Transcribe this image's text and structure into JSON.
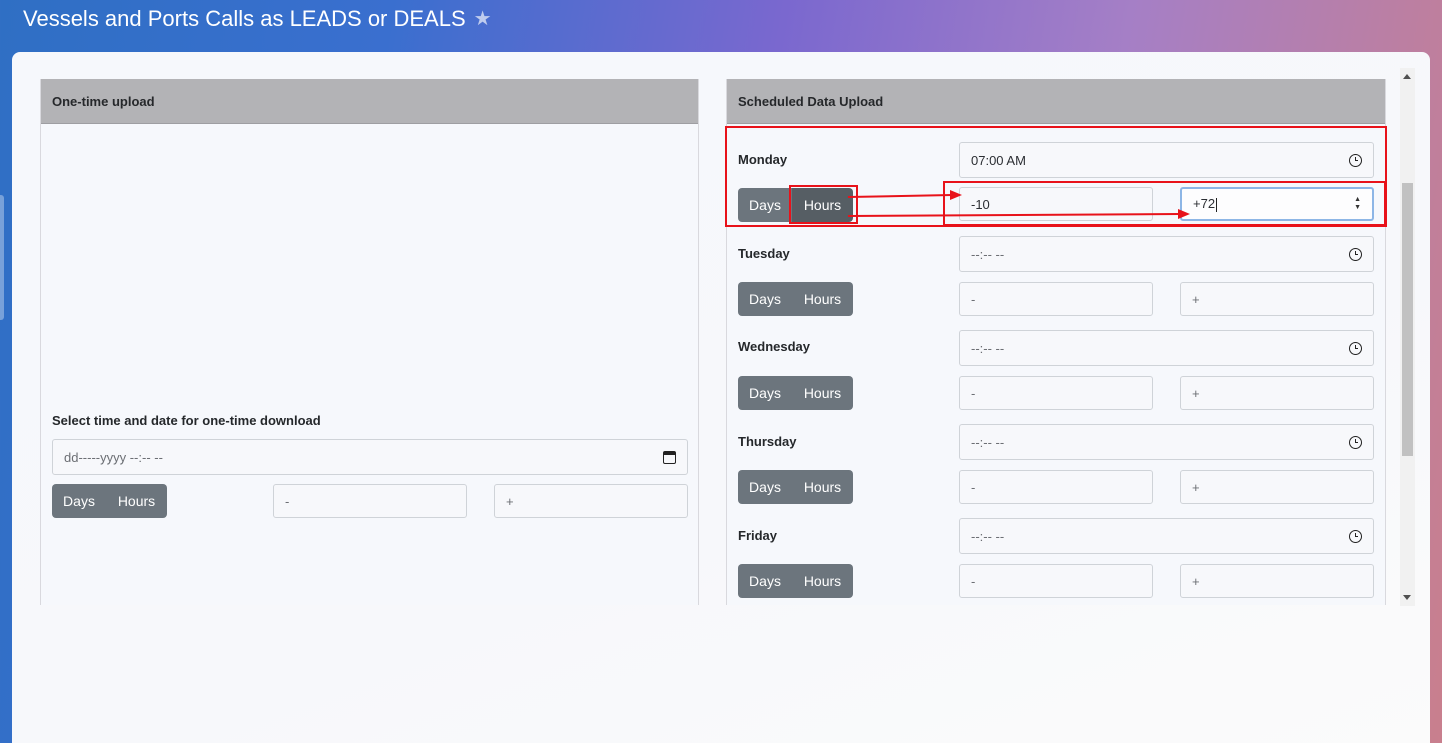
{
  "page": {
    "title": "Vessels and Ports Calls as LEADS or DEALS",
    "favorite_icon": "star-icon"
  },
  "one_time": {
    "header": "One-time upload",
    "select_label": "Select time and date for one-time download",
    "datetime_placeholder": "dd-----yyyy --:-- --",
    "days_label": "Days",
    "hours_label": "Hours",
    "minus_placeholder": "-",
    "plus_placeholder": "+"
  },
  "scheduled": {
    "header": "Scheduled Data Upload",
    "days": [
      {
        "name": "Monday",
        "time": "07:00 AM",
        "days_label": "Days",
        "hours_label": "Hours",
        "minus": "-10",
        "plus": "+72"
      },
      {
        "name": "Tuesday",
        "time": "--:-- --",
        "days_label": "Days",
        "hours_label": "Hours",
        "minus": "-",
        "plus": "+"
      },
      {
        "name": "Wednesday",
        "time": "--:-- --",
        "days_label": "Days",
        "hours_label": "Hours",
        "minus": "-",
        "plus": "+"
      },
      {
        "name": "Thursday",
        "time": "--:-- --",
        "days_label": "Days",
        "hours_label": "Hours",
        "minus": "-",
        "plus": "+"
      },
      {
        "name": "Friday",
        "time": "--:-- --",
        "days_label": "Days",
        "hours_label": "Hours",
        "minus": "-",
        "plus": "+"
      }
    ]
  },
  "colors": {
    "annotation": "#e8121a",
    "button": "#6c757d",
    "panel_header": "#b3b3b6"
  }
}
